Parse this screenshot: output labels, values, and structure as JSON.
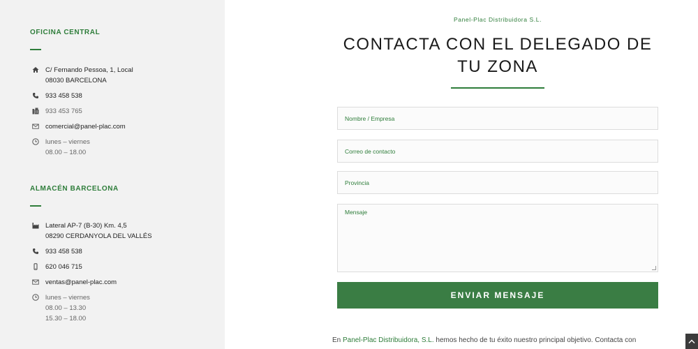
{
  "sidebar": {
    "office": {
      "title": "OFICINA CENTRAL",
      "address_line1": "C/ Fernando Pessoa, 1, Local",
      "address_line2": "08030 BARCELONA",
      "phone": "933 458 538",
      "fax": "933 453 765",
      "email": "comercial@panel-plac.com",
      "hours_days": "lunes – viernes",
      "hours_time": "08.00 – 18.00"
    },
    "warehouse": {
      "title": "ALMACÉN BARCELONA",
      "address_line1": "Lateral AP-7 (B-30) Km. 4,5",
      "address_line2": "08290 CERDANYOLA DEL VALLÉS",
      "phone": "933 458 538",
      "mobile": "620 046 715",
      "email": "ventas@panel-plac.com",
      "hours_days": "lunes – viernes",
      "hours_morning": "08.00 – 13.30",
      "hours_afternoon": "15.30 – 18.00"
    }
  },
  "main": {
    "eyebrow": "Panel-Plac Distribuidora S.L.",
    "title": "CONTACTA CON EL DELEGADO DE TU ZONA",
    "form": {
      "name_placeholder": "Nombre / Empresa",
      "email_placeholder": "Correo de contacto",
      "province_placeholder": "Provincia",
      "message_placeholder": "Mensaje",
      "submit_label": "ENVIAR MENSAJE"
    },
    "intro": {
      "prefix": "En ",
      "brand": "Panel-Plac Distribuidora, S.L.",
      "suffix": " hemos hecho de tu éxito nuestro principal objetivo. Contacta con"
    }
  },
  "colors": {
    "accent": "#2e7d3a",
    "button": "#3a7d44",
    "sidebar_bg": "#f2f2f2"
  },
  "icons": [
    "home-icon",
    "phone-icon",
    "fax-icon",
    "mail-icon",
    "clock-icon",
    "factory-icon",
    "mobile-icon",
    "chevron-up-icon"
  ]
}
